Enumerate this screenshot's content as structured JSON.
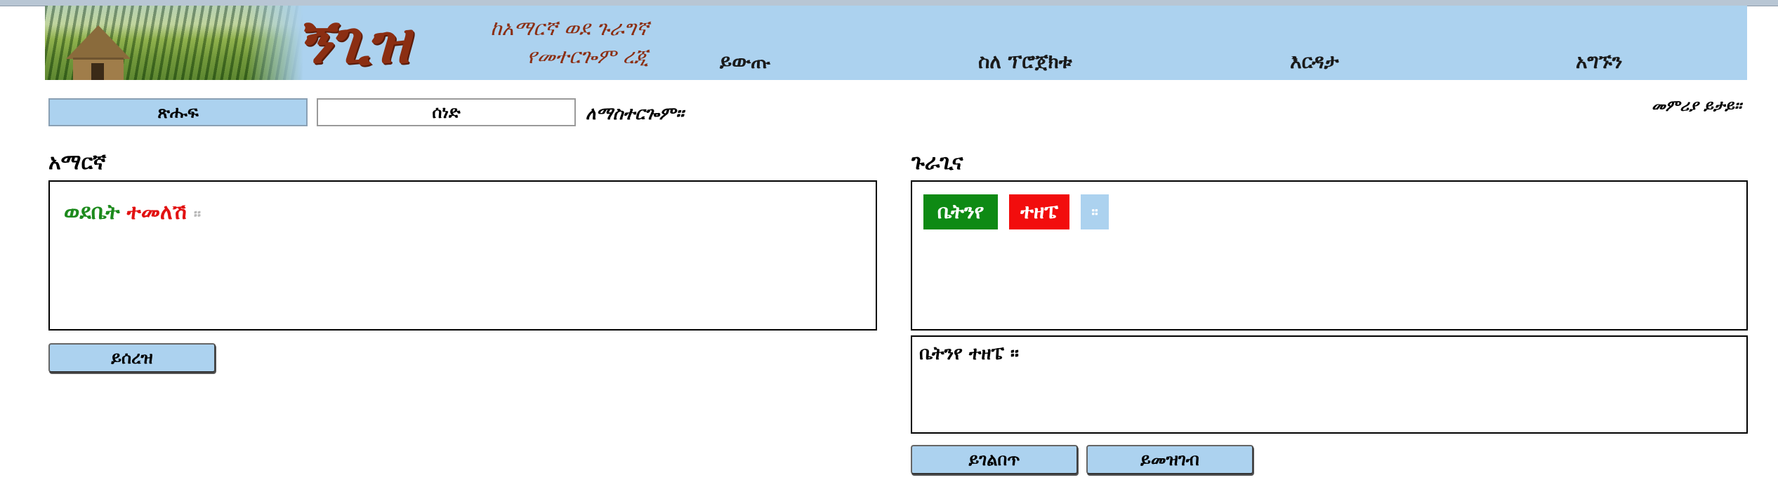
{
  "header": {
    "logo_text": "ኝጊዝ",
    "tagline_line1": "ከአማርኛ ወደ ጉራግኛ",
    "tagline_line2": "የመተርጐም ረጂ",
    "nav": [
      "ይውጡ",
      "ስለ ፕሮጀክቱ",
      "እርዳታ",
      "አግኙን"
    ]
  },
  "tabs": {
    "text": "ጽሑፍ",
    "document": "ሰነድ"
  },
  "translate_label": "ለማስተርጐም።",
  "instructions": "መምሪያ ይታይ።",
  "source": {
    "title": "አማርኛ",
    "words": [
      {
        "text": "ወደቤት",
        "color": "#1c8a1c"
      },
      {
        "text": "ተመለሽ",
        "color": "#e21212"
      }
    ],
    "punctuation": "።",
    "clear_button": "ይሰረዝ"
  },
  "target": {
    "title": "ጉራጊና",
    "chips": [
      {
        "text": "ቤትንየ",
        "color": "#0e8a14"
      },
      {
        "text": "ተዘፔ",
        "color": "#f20d0d"
      },
      {
        "text": "።",
        "color": "#acd2ef"
      }
    ],
    "result_text": "ቤትንየ ተዘፔ ።",
    "buttons": {
      "flip": "ይገልበጥ",
      "record": "ይመዝገብ"
    }
  },
  "colors": {
    "header_bg": "#acd2ef",
    "logo_red": "#8b2e12"
  }
}
